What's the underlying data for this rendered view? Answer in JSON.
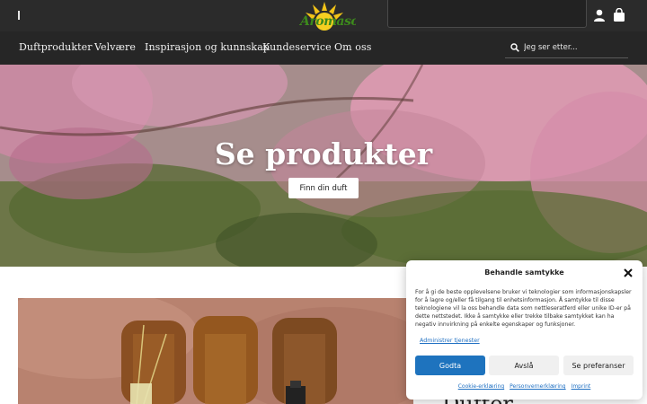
{
  "header": {
    "logo_text": "Aromasol",
    "icons": [
      "user-icon",
      "shopping-bag-icon"
    ]
  },
  "nav": {
    "items": [
      "Duftprodukter",
      "Velvære",
      "Inspirasjon og kunnskap",
      "Kundeservice",
      "Om oss"
    ],
    "search_placeholder": "Jeg ser etter..."
  },
  "hero": {
    "title": "Se produkter",
    "button_label": "Finn din duft"
  },
  "content": {
    "partial_heading": "Dufter"
  },
  "consent": {
    "title": "Behandle samtykke",
    "text": "For å gi de beste opplevelsene bruker vi teknologier som informasjonskapsler for å lagre og/eller få tilgang til enhetsinformasjon. Å samtykke til disse teknologiene vil la oss behandle data som nettleseratferd eller unike ID-er på dette nettstedet. Ikke å samtykke eller trekke tilbake samtykket kan ha negativ innvirkning på enkelte egenskaper og funksjoner.",
    "manage_link": "Administrer tjenester",
    "accept_label": "Godta",
    "deny_label": "Avslå",
    "preferences_label": "Se preferanser",
    "links": [
      "Cookie-erklæring",
      "Personvernerklæring",
      "Imprint"
    ]
  },
  "colors": {
    "topbar": "#2b2b2b",
    "nav": "#262626",
    "accent": "#1e73be",
    "logo_green": "#3d8a1c",
    "logo_sun": "#f2c318"
  }
}
